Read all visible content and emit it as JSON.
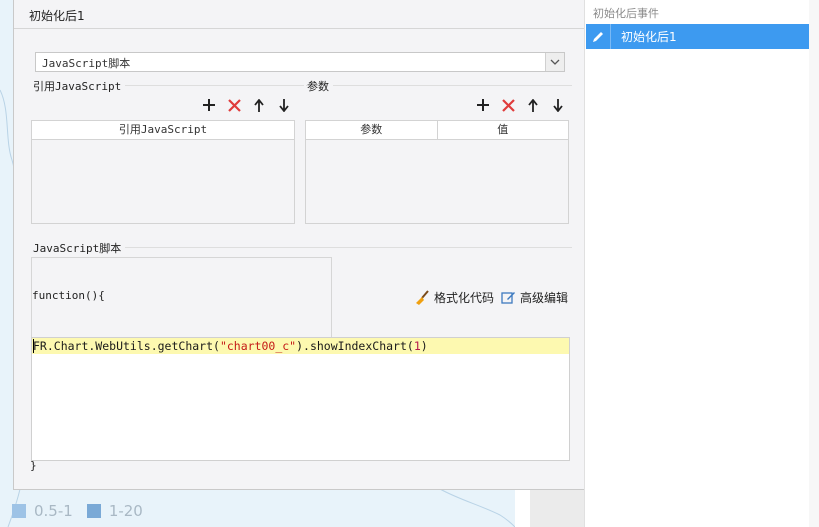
{
  "dialog": {
    "tab_title": "初始化后1",
    "script_type": {
      "selected": "JavaScript脚本"
    },
    "ref_section": {
      "title": "引用JavaScript",
      "column": "引用JavaScript"
    },
    "param_section": {
      "title": "参数",
      "columns": [
        "参数",
        "值"
      ]
    },
    "script_section": {
      "title": "JavaScript脚本"
    },
    "function_open": "function(){",
    "function_close": "}",
    "format_code_label": "格式化代码",
    "advanced_edit_label": "高级编辑",
    "code": {
      "prefix": "FR.Chart.WebUtils.getChart(",
      "string_arg": "\"chart00_c\"",
      "middle": ").showIndexChart(",
      "number_arg": "1",
      "suffix": ")"
    }
  },
  "right_panel": {
    "title": "初始化后事件",
    "items": [
      {
        "label": "初始化后1",
        "selected": true
      }
    ]
  },
  "background": {
    "legend": [
      {
        "label": "0.5-1",
        "color": "#9ec3e6"
      },
      {
        "label": "1-20",
        "color": "#7aa9d6"
      }
    ]
  },
  "colors": {
    "accent": "#3d9af0",
    "add_icon": "#222222",
    "delete_icon": "#e03c3c",
    "highlight_line": "#fdf9b0"
  }
}
